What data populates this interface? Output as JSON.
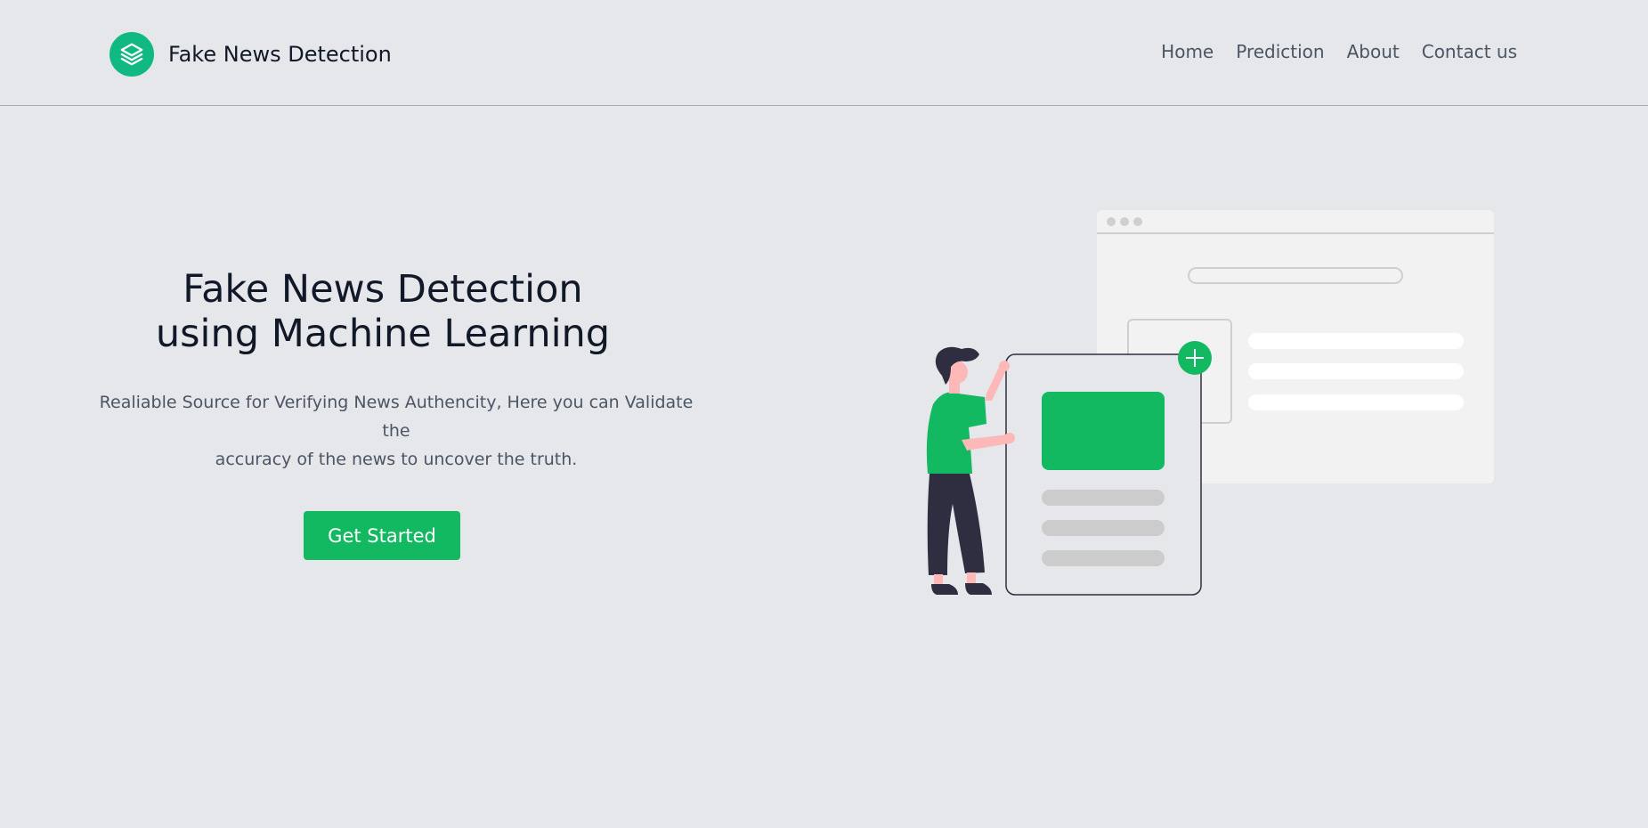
{
  "header": {
    "brand_name": "Fake News Detection",
    "logo_icon": "layers-icon",
    "nav": [
      {
        "label": "Home"
      },
      {
        "label": "Prediction"
      },
      {
        "label": "About"
      },
      {
        "label": "Contact us"
      }
    ]
  },
  "hero": {
    "title_line1": "Fake News Detection",
    "title_line2": "using Machine Learning",
    "subtitle_line1": "Realiable Source for Verifying News Authencity, Here you can Validate the",
    "subtitle_line2": "accuracy of the news to uncover the truth.",
    "cta_label": "Get Started"
  },
  "colors": {
    "accent": "#13b960",
    "logo": "#10b981",
    "background": "#e5e7eb",
    "text_dark": "#111827",
    "text_muted": "#4b5563"
  }
}
